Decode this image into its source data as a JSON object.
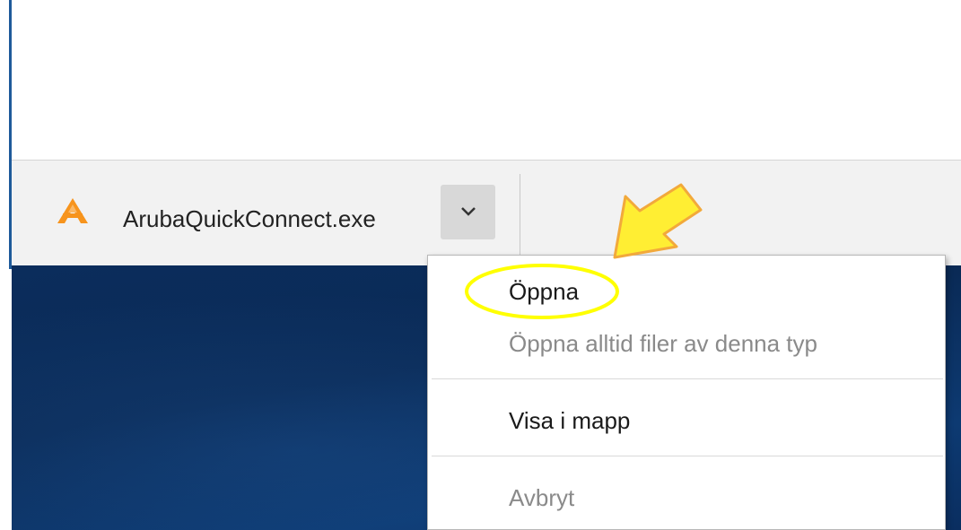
{
  "download": {
    "file_name": "ArubaQuickConnect.exe",
    "icon": "aruba-a-icon",
    "menu_toggle_icon": "chevron-down-icon"
  },
  "context_menu": {
    "items": [
      {
        "label": "Öppna",
        "enabled": true
      },
      {
        "label": "Öppna alltid filer av denna typ",
        "enabled": false
      },
      {
        "label": "Visa i mapp",
        "enabled": true
      },
      {
        "label": "Avbryt",
        "enabled": false
      }
    ]
  },
  "annotations": {
    "highlight_color": "#ffff00",
    "arrow_fill": "#ffee33",
    "arrow_stroke": "#f2a93b"
  },
  "colors": {
    "aruba_orange": "#f7941d",
    "desktop_blue": "#0b2d5c"
  }
}
